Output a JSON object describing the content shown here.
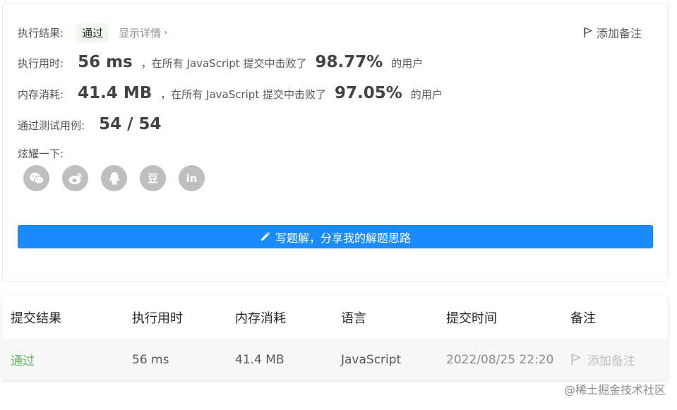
{
  "result": {
    "label": "执行结果:",
    "status": "通过",
    "details_link": "显示详情",
    "chevron": "›",
    "add_note": "添加备注"
  },
  "runtime": {
    "label": "执行用时:",
    "value": "56 ms",
    "desc": "，在所有 JavaScript 提交中击败了",
    "percent": "98.77%",
    "suffix": "的用户"
  },
  "memory": {
    "label": "内存消耗:",
    "value": "41.4 MB",
    "desc": "，在所有 JavaScript 提交中击败了",
    "percent": "97.05%",
    "suffix": "的用户"
  },
  "tests": {
    "label": "通过测试用例:",
    "value": "54 / 54"
  },
  "share": {
    "label": "炫耀一下:",
    "icons": [
      "wechat-icon",
      "weibo-icon",
      "qq-icon",
      "douban-icon",
      "linkedin-icon"
    ],
    "douban_glyph": "豆",
    "linkedin_glyph": "in"
  },
  "solution_button": "写题解，分享我的解题思路",
  "table": {
    "headers": [
      "提交结果",
      "执行用时",
      "内存消耗",
      "语言",
      "提交时间",
      "备注"
    ],
    "rows": [
      {
        "status": "通过",
        "runtime": "56 ms",
        "memory": "41.4 MB",
        "language": "JavaScript",
        "time": "2022/08/25 22:20",
        "note": "添加备注"
      }
    ]
  },
  "watermark": "@稀土掘金技术社区",
  "colors": {
    "accent": "#1a8cff",
    "pass_green": "#5cb85c",
    "icon_gray": "#bfbfbf"
  }
}
